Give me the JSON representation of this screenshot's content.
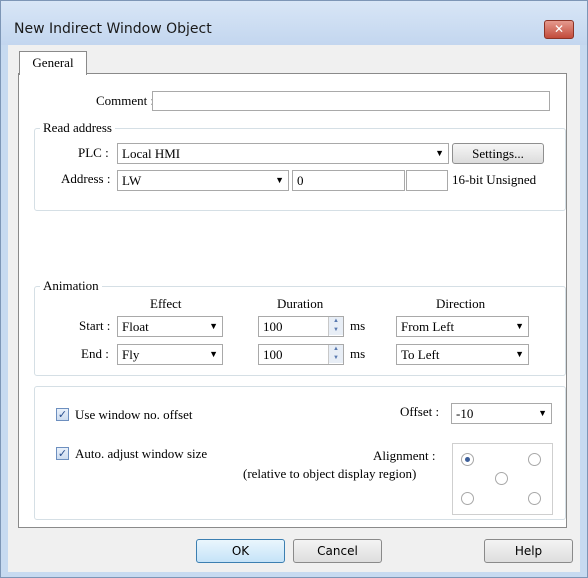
{
  "window": {
    "title": "New Indirect Window Object",
    "close_glyph": "✕"
  },
  "tabs": [
    {
      "label": "General"
    }
  ],
  "comment": {
    "label": "Comment :",
    "value": ""
  },
  "read_address": {
    "title": "Read address",
    "plc_label": "PLC :",
    "plc_value": "Local HMI",
    "settings_label": "Settings...",
    "address_label": "Address :",
    "address_type": "LW",
    "address_value": "0",
    "address_extra": "",
    "data_format": "16-bit Unsigned"
  },
  "animation": {
    "title": "Animation",
    "col_effect": "Effect",
    "col_duration": "Duration",
    "col_direction": "Direction",
    "start": {
      "label": "Start :",
      "effect": "Float",
      "duration": "100",
      "unit": "ms",
      "direction": "From Left"
    },
    "end": {
      "label": "End :",
      "effect": "Fly",
      "duration": "100",
      "unit": "ms",
      "direction": "To Left"
    }
  },
  "options": {
    "use_offset_label": "Use window no. offset",
    "use_offset_checked": true,
    "auto_adjust_label": "Auto. adjust window size",
    "auto_adjust_checked": true,
    "offset_label": "Offset :",
    "offset_value": "-10",
    "alignment_label": "Alignment :",
    "alignment_note": "(relative to object display region)",
    "alignment_selected": "top-left"
  },
  "footer": {
    "ok": "OK",
    "cancel": "Cancel",
    "help": "Help"
  },
  "icons": {
    "dropdown": "chevron-down-icon",
    "check": "checkmark-icon",
    "close": "close-icon"
  }
}
